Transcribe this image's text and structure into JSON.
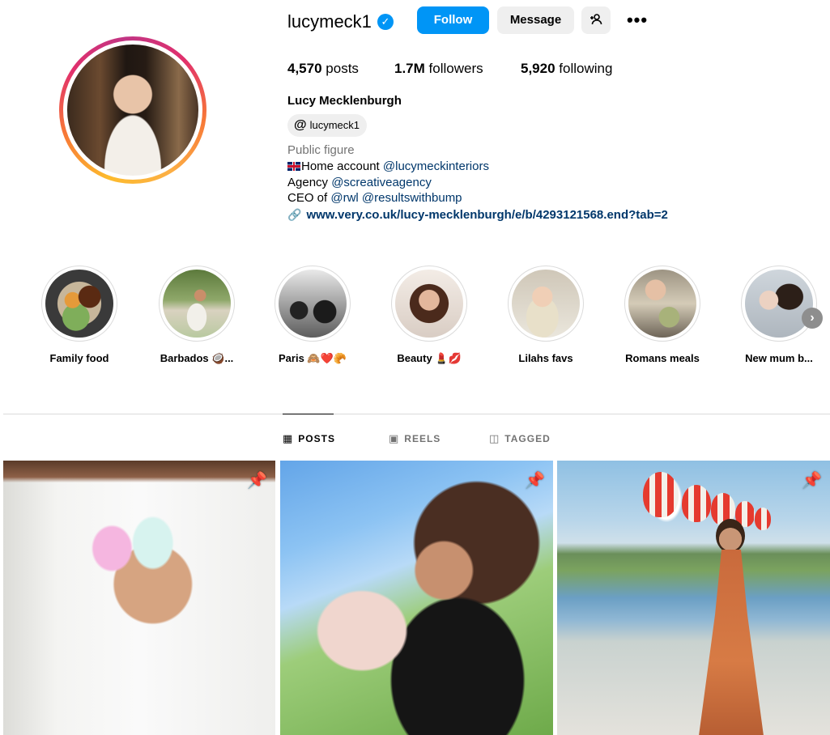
{
  "profile": {
    "username": "lucymeck1",
    "follow_label": "Follow",
    "message_label": "Message",
    "add_user_icon": "add-person-icon",
    "more_label": "•••",
    "stats": {
      "posts_count": "4,570",
      "posts_label": "posts",
      "followers_count": "1.7M",
      "followers_label": "followers",
      "following_count": "5,920",
      "following_label": "following"
    },
    "full_name": "Lucy Mecklenburgh",
    "threads_handle": "lucymeck1",
    "category": "Public figure",
    "bio": {
      "line1_text": "Home account ",
      "line1_mention": "@lucymeckinteriors",
      "line2_text": "Agency ",
      "line2_mention": "@screativeagency",
      "line3_text": "CEO of ",
      "line3_mention1": "@rwl",
      "line3_mention2": "@resultswithbump"
    },
    "link": "www.very.co.uk/lucy-mecklenburgh/e/b/4293121568.end?tab=2"
  },
  "highlights": [
    {
      "label": "Family food"
    },
    {
      "label": "Barbados 🥥..."
    },
    {
      "label": "Paris 🙈❤️🥐"
    },
    {
      "label": "Beauty 💄💋"
    },
    {
      "label": "Lilahs favs"
    },
    {
      "label": "Romans meals"
    },
    {
      "label": "New mum b..."
    }
  ],
  "tabs": [
    {
      "label": "POSTS",
      "icon": "grid-icon",
      "active": true
    },
    {
      "label": "REELS",
      "icon": "reels-icon",
      "active": false
    },
    {
      "label": "TAGGED",
      "icon": "tagged-icon",
      "active": false
    }
  ],
  "colors": {
    "accent": "#0095f6",
    "link": "#00376b",
    "secondary_text": "#737373"
  }
}
